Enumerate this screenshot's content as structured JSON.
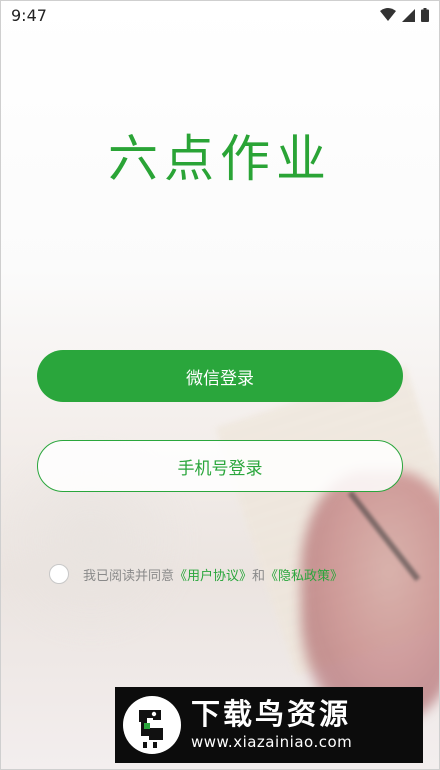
{
  "status_bar": {
    "time": "9:47"
  },
  "app": {
    "logo_text": "六点作业"
  },
  "buttons": {
    "wechat_login": "微信登录",
    "phone_login": "手机号登录"
  },
  "agreement": {
    "prefix": "我已阅读并同意",
    "user_agreement": "《用户协议》",
    "conjunction": "和",
    "privacy_policy": "《隐私政策》"
  },
  "watermark": {
    "title": "下载鸟资源",
    "url": "www.xiazainiao.com"
  },
  "colors": {
    "brand_green": "#2aa63c",
    "text_gray": "#8a8a8a"
  },
  "icons": {
    "status": [
      "wifi-icon",
      "signal-icon",
      "battery-icon"
    ]
  }
}
